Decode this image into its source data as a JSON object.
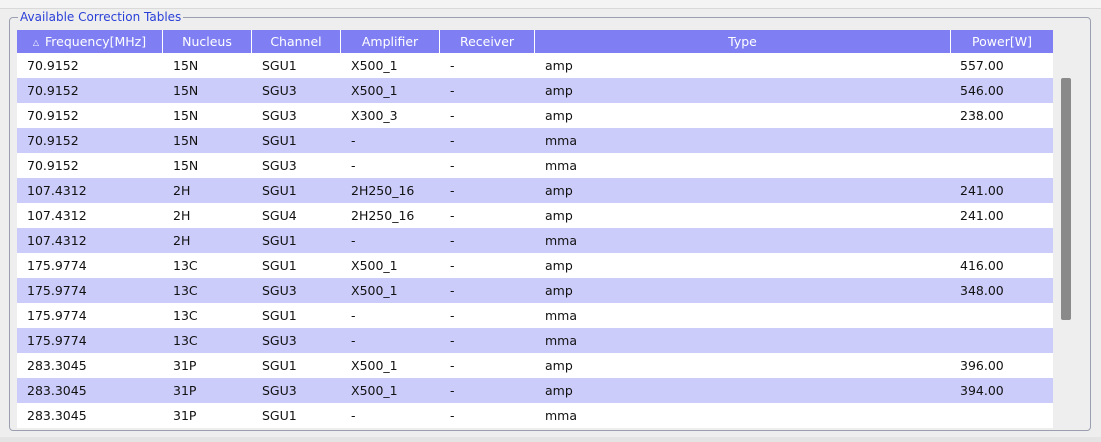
{
  "panel": {
    "title": "Available Correction Tables"
  },
  "table": {
    "columns": [
      "Frequency[MHz]",
      "Nucleus",
      "Channel",
      "Amplifier",
      "Receiver",
      "Type",
      "Power[W]"
    ],
    "sort_icon": "△",
    "rows": [
      [
        "70.9152",
        "15N",
        "SGU1",
        "X500_1",
        "-",
        "amp",
        "557.00"
      ],
      [
        "70.9152",
        "15N",
        "SGU3",
        "X500_1",
        "-",
        "amp",
        "546.00"
      ],
      [
        "70.9152",
        "15N",
        "SGU3",
        "X300_3",
        "-",
        "amp",
        "238.00"
      ],
      [
        "70.9152",
        "15N",
        "SGU1",
        "-",
        "-",
        "mma",
        ""
      ],
      [
        "70.9152",
        "15N",
        "SGU3",
        "-",
        "-",
        "mma",
        ""
      ],
      [
        "107.4312",
        "2H",
        "SGU1",
        "2H250_16",
        "-",
        "amp",
        "241.00"
      ],
      [
        "107.4312",
        "2H",
        "SGU4",
        "2H250_16",
        "-",
        "amp",
        "241.00"
      ],
      [
        "107.4312",
        "2H",
        "SGU1",
        "-",
        "-",
        "mma",
        ""
      ],
      [
        "175.9774",
        "13C",
        "SGU1",
        "X500_1",
        "-",
        "amp",
        "416.00"
      ],
      [
        "175.9774",
        "13C",
        "SGU3",
        "X500_1",
        "-",
        "amp",
        "348.00"
      ],
      [
        "175.9774",
        "13C",
        "SGU1",
        "-",
        "-",
        "mma",
        ""
      ],
      [
        "175.9774",
        "13C",
        "SGU3",
        "-",
        "-",
        "mma",
        ""
      ],
      [
        "283.3045",
        "31P",
        "SGU1",
        "X500_1",
        "-",
        "amp",
        "396.00"
      ],
      [
        "283.3045",
        "31P",
        "SGU3",
        "X500_1",
        "-",
        "amp",
        "394.00"
      ],
      [
        "283.3045",
        "31P",
        "SGU1",
        "-",
        "-",
        "mma",
        ""
      ]
    ]
  },
  "colors": {
    "header_bg": "#7f7ff3",
    "alt_row_bg": "#ccccfa",
    "panel_title": "#2a3fd8"
  }
}
